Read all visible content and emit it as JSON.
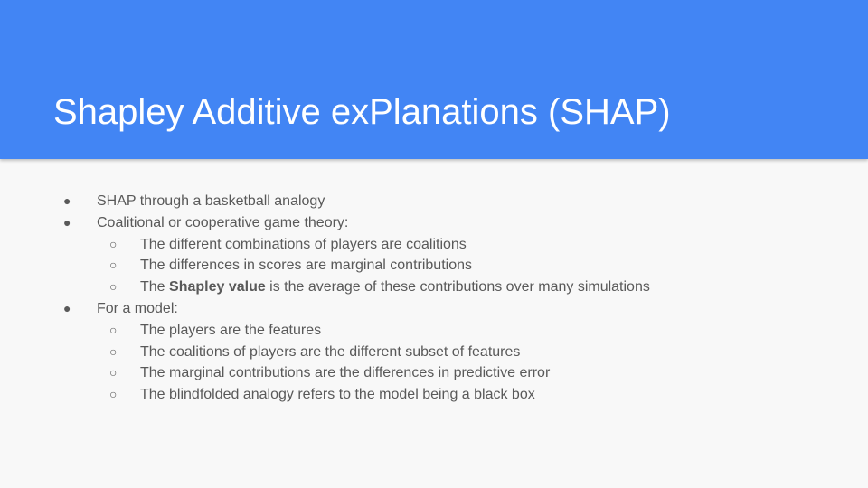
{
  "slide": {
    "title": "Shapley Additive exPlanations (SHAP)",
    "bullets": [
      {
        "level": 1,
        "marker": "●",
        "text": "SHAP through a basketball analogy"
      },
      {
        "level": 1,
        "marker": "●",
        "text": "Coalitional or cooperative game theory:"
      },
      {
        "level": 2,
        "marker": "○",
        "text": "The different combinations of players are coalitions"
      },
      {
        "level": 2,
        "marker": "○",
        "text": "The differences in scores are marginal contributions"
      },
      {
        "level": 2,
        "marker": "○",
        "text_before": "The ",
        "text_bold": "Shapley value",
        "text_after": " is the average of these contributions over many simulations"
      },
      {
        "level": 1,
        "marker": "●",
        "text": "For a model:"
      },
      {
        "level": 2,
        "marker": "○",
        "text": "The players are the features"
      },
      {
        "level": 2,
        "marker": "○",
        "text": "The coalitions of players are the different subset of features"
      },
      {
        "level": 2,
        "marker": "○",
        "text": "The marginal contributions are the differences in predictive error"
      },
      {
        "level": 2,
        "marker": "○",
        "text": "The blindfolded analogy refers to the model being a black box"
      }
    ]
  },
  "colors": {
    "header_bg": "#4285f4",
    "title_text": "#ffffff",
    "body_bg": "#f8f8f8",
    "body_text": "#595959"
  }
}
